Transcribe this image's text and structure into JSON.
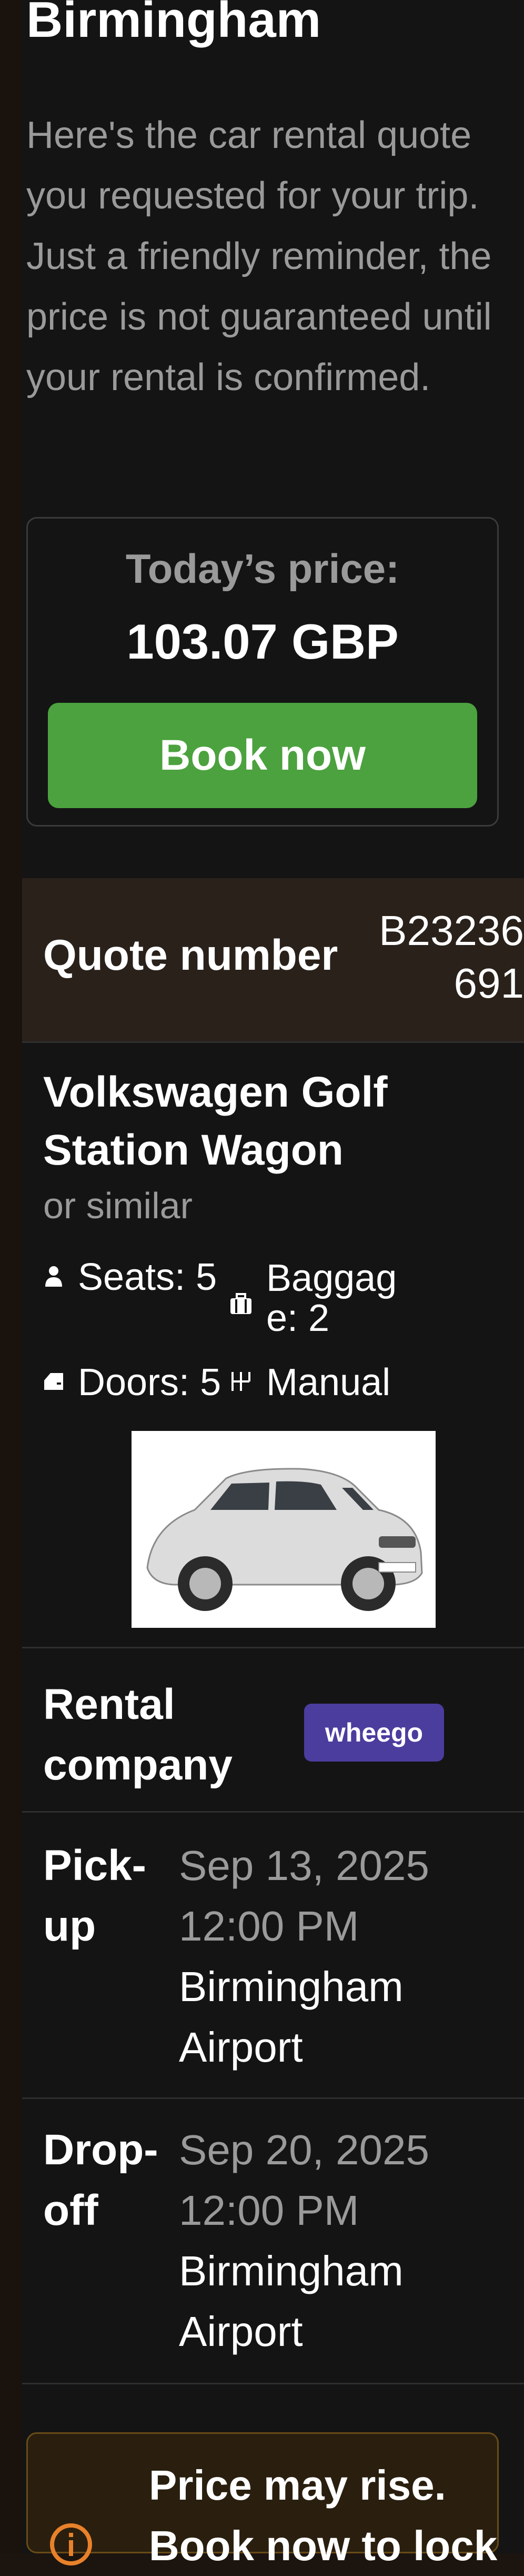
{
  "title": "Birmingham",
  "intro": "Here's the car rental quote you requested for your trip. Just a friendly reminder, the price is not guaranteed until your rental is confirmed.",
  "price": {
    "label": "Today’s price:",
    "value": "103.07 GBP",
    "book_label": "Book now"
  },
  "quote": {
    "label": "Quote number",
    "value": "B23236691"
  },
  "car": {
    "name_line1": "Volkswagen Golf",
    "name_line2": "Station Wagon",
    "similar": "or similar",
    "seats": "Seats: 5",
    "baggage_line1": "Baggag",
    "baggage_line2": "e: 2",
    "doors": "Doors: 5",
    "transmission": "Manual"
  },
  "rental_company": {
    "label_line1": "Rental",
    "label_line2": "company",
    "logo_text": "wheego"
  },
  "pickup": {
    "label_line1": "Pick-",
    "label_line2": "up",
    "date": "Sep 13, 2025",
    "time": "12:00 PM",
    "place_line1": "Birmingham",
    "place_line2": "Airport"
  },
  "dropoff": {
    "label_line1": "Drop-",
    "label_line2": "off",
    "date": "Sep 20, 2025",
    "time": "12:00 PM",
    "place_line1": "Birmingham",
    "place_line2": "Airport"
  },
  "warning": {
    "line1": "Price may rise.",
    "line2": "Book now to lock"
  },
  "colors": {
    "accent_green": "#4ba23e",
    "logo_purple": "#4b3d9e",
    "warning_orange": "#e8812a"
  }
}
